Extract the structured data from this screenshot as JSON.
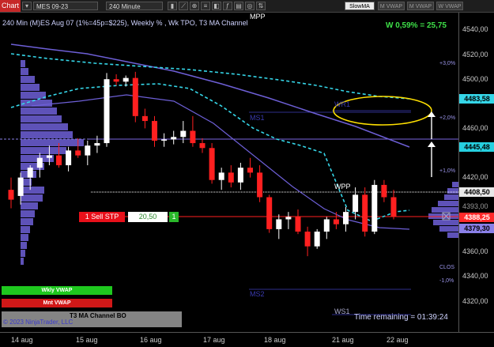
{
  "toolbar": {
    "chart_label": "Chart",
    "instrument": "MES 09-23",
    "interval": "240 Minute",
    "slowma_label": "SlowMA",
    "mvwap_label": "M VWAP",
    "mvwap2_label": "M VWAP",
    "wvwap_label": "W VWAP"
  },
  "chart": {
    "header": "240 Min (M)ES Aug 07 (1%=45p=$225), Weekly % , Wk TPO, T3 MA Channel",
    "weekly_change": "W 0,59% = 25,75",
    "copyright": "© 2023 NinjaTrader, LLC",
    "time_remaining": "Time remaining = 01:39:24",
    "levels": {
      "mpp": "MPP",
      "wr1": "WR1",
      "ms1": "MS1",
      "wpp": "WPP",
      "ms2": "MS2",
      "ws1": "WS1"
    },
    "pct_labels": {
      "p3": "+3,0%",
      "p2": "+2,0%",
      "p1": "+1,0%",
      "clos": "CLOS",
      "m1": "-1,0%"
    },
    "order": {
      "label": "1 Sell STP",
      "price": "20,50",
      "qty": "1"
    },
    "legend": {
      "wkly": "Wkly VWAP",
      "mnt": "Mnt VWAP",
      "t3": "T3 MA Channel BO"
    }
  },
  "price_axis": {
    "labels": [
      "4540,00",
      "4520,00",
      "4500,00",
      "4480,00",
      "4460,00",
      "4440,00",
      "4420,00",
      "4400,00",
      "4380,00",
      "4360,00",
      "4340,00",
      "4320,00"
    ],
    "tags": [
      {
        "text": "4483,58",
        "color": "#35d6e8"
      },
      {
        "text": "4445,48",
        "color": "#26d0e0"
      },
      {
        "text": "4408,50",
        "color": "#e8e8e8"
      },
      {
        "text": "4388,25",
        "color": "#ff2a2a"
      },
      {
        "text": "4379,30",
        "color": "#8a80e8"
      }
    ],
    "partial": "4393,00"
  },
  "x_axis": {
    "labels": [
      "14 aug",
      "15 aug",
      "16 aug",
      "17 aug",
      "18 aug",
      "21 aug",
      "22 aug"
    ]
  },
  "colors": {
    "up": "#ffffff",
    "down": "#ff2020",
    "t3": "#35d6e8",
    "ma": "#7a66e0",
    "profile": "#7b6fe0"
  },
  "candles": [
    {
      "o": 4410,
      "h": 4420,
      "l": 4395,
      "c": 4402
    },
    {
      "o": 4405,
      "h": 4424,
      "l": 4398,
      "c": 4420
    },
    {
      "o": 4420,
      "h": 4430,
      "l": 4410,
      "c": 4428
    },
    {
      "o": 4428,
      "h": 4440,
      "l": 4420,
      "c": 4436
    },
    {
      "o": 4436,
      "h": 4446,
      "l": 4430,
      "c": 4438
    },
    {
      "o": 4438,
      "h": 4448,
      "l": 4428,
      "c": 4430
    },
    {
      "o": 4430,
      "h": 4445,
      "l": 4425,
      "c": 4442
    },
    {
      "o": 4442,
      "h": 4452,
      "l": 4436,
      "c": 4438
    },
    {
      "o": 4438,
      "h": 4450,
      "l": 4430,
      "c": 4446
    },
    {
      "o": 4446,
      "h": 4454,
      "l": 4440,
      "c": 4448
    },
    {
      "o": 4448,
      "h": 4505,
      "l": 4445,
      "c": 4500
    },
    {
      "o": 4500,
      "h": 4504,
      "l": 4495,
      "c": 4498
    },
    {
      "o": 4498,
      "h": 4503,
      "l": 4494,
      "c": 4501
    },
    {
      "o": 4501,
      "h": 4506,
      "l": 4465,
      "c": 4470
    },
    {
      "o": 4470,
      "h": 4476,
      "l": 4460,
      "c": 4466
    },
    {
      "o": 4466,
      "h": 4470,
      "l": 4445,
      "c": 4450
    },
    {
      "o": 4450,
      "h": 4456,
      "l": 4445,
      "c": 4451
    },
    {
      "o": 4451,
      "h": 4458,
      "l": 4447,
      "c": 4453
    },
    {
      "o": 4453,
      "h": 4466,
      "l": 4448,
      "c": 4458
    },
    {
      "o": 4458,
      "h": 4470,
      "l": 4445,
      "c": 4448
    },
    {
      "o": 4448,
      "h": 4452,
      "l": 4440,
      "c": 4444
    },
    {
      "o": 4444,
      "h": 4448,
      "l": 4415,
      "c": 4418
    },
    {
      "o": 4418,
      "h": 4428,
      "l": 4410,
      "c": 4424
    },
    {
      "o": 4424,
      "h": 4430,
      "l": 4412,
      "c": 4416
    },
    {
      "o": 4416,
      "h": 4432,
      "l": 4410,
      "c": 4428
    },
    {
      "o": 4428,
      "h": 4436,
      "l": 4420,
      "c": 4424
    },
    {
      "o": 4424,
      "h": 4430,
      "l": 4400,
      "c": 4404
    },
    {
      "o": 4404,
      "h": 4406,
      "l": 4375,
      "c": 4378
    },
    {
      "o": 4378,
      "h": 4390,
      "l": 4370,
      "c": 4386
    },
    {
      "o": 4386,
      "h": 4392,
      "l": 4378,
      "c": 4388
    },
    {
      "o": 4388,
      "h": 4394,
      "l": 4374,
      "c": 4376
    },
    {
      "o": 4376,
      "h": 4380,
      "l": 4356,
      "c": 4364
    },
    {
      "o": 4364,
      "h": 4378,
      "l": 4362,
      "c": 4376
    },
    {
      "o": 4376,
      "h": 4388,
      "l": 4370,
      "c": 4386
    },
    {
      "o": 4386,
      "h": 4392,
      "l": 4378,
      "c": 4382
    },
    {
      "o": 4382,
      "h": 4396,
      "l": 4376,
      "c": 4392
    },
    {
      "o": 4392,
      "h": 4412,
      "l": 4386,
      "c": 4406
    },
    {
      "o": 4406,
      "h": 4412,
      "l": 4372,
      "c": 4376
    },
    {
      "o": 4376,
      "h": 4418,
      "l": 4374,
      "c": 4414
    },
    {
      "o": 4414,
      "h": 4418,
      "l": 4400,
      "c": 4404
    },
    {
      "o": 4404,
      "h": 4410,
      "l": 4386,
      "c": 4388
    }
  ]
}
